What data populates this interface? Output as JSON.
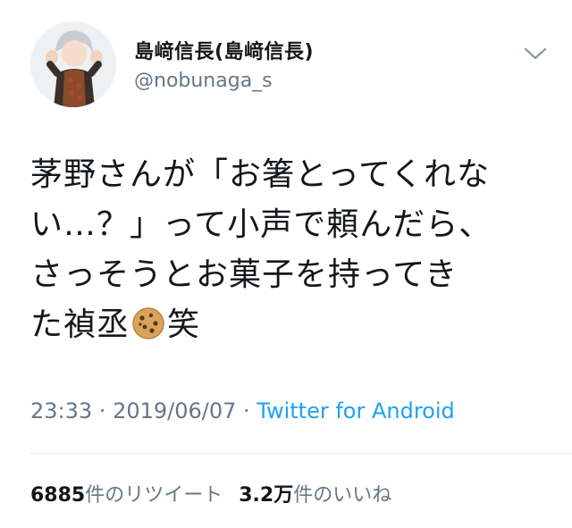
{
  "user": {
    "display_name": "島﨑信長(島﨑信長)",
    "handle": "@nobunaga_s"
  },
  "tweet": {
    "lines": [
      "茅野さんが「お箸とってくれな",
      "い…？」って小声で頼んだら、",
      "さっそうとお菓子を持ってき"
    ],
    "last_line_before_emoji": "た禎丞",
    "last_line_after_emoji": "笑",
    "emoji": "cookie-icon"
  },
  "meta": {
    "time": "23:33",
    "sep1": " · ",
    "date": "2019/06/07",
    "sep2": " · ",
    "source": "Twitter for Android"
  },
  "stats": {
    "retweets_count": "6885",
    "retweets_label": "件のリツイート",
    "likes_count": "3.2万",
    "likes_label": "件のいいね"
  },
  "colors": {
    "text": "#14171a",
    "secondary": "#657786",
    "link": "#1da1f2",
    "divider": "#e1e8ed"
  }
}
